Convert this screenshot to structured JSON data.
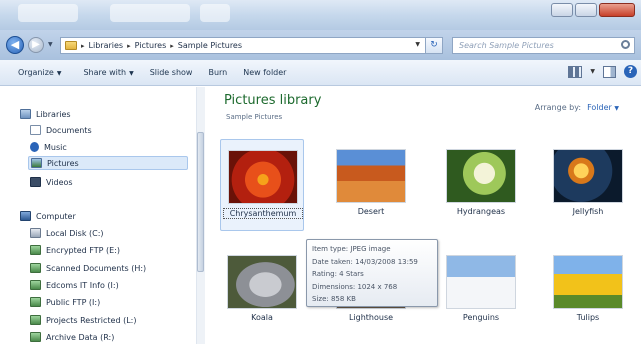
{
  "address": {
    "crumbs": [
      "Libraries",
      "Pictures",
      "Sample Pictures"
    ],
    "search_placeholder": "Search Sample Pictures"
  },
  "toolbar": {
    "organize": "Organize",
    "share_with": "Share with",
    "slide_show": "Slide show",
    "burn": "Burn",
    "new_folder": "New folder"
  },
  "sidebar": {
    "libraries": "Libraries",
    "documents": "Documents",
    "music": "Music",
    "pictures": "Pictures",
    "videos": "Videos",
    "computer": "Computer",
    "drives": [
      "Local Disk (C:)",
      "Encrypted FTP (E:)",
      "Scanned Documents (H:)",
      "Edcoms IT Info (I:)",
      "Public FTP (I:)",
      "Projects Restricted (L:)",
      "Archive Data (R:)"
    ]
  },
  "main": {
    "title": "Pictures library",
    "subtitle": "Sample Pictures",
    "arrange_label": "Arrange by:",
    "arrange_value": "Folder",
    "items": [
      "Chrysanthemum",
      "Desert",
      "Hydrangeas",
      "Jellyfish",
      "Koala",
      "Lighthouse",
      "Penguins",
      "Tulips"
    ]
  },
  "tooltip": {
    "item_type": "Item type: JPEG image",
    "date_taken": "Date taken: 14/03/2008 13:59",
    "rating": "Rating: 4 Stars",
    "dimensions": "Dimensions: 1024 x 768",
    "size": "Size: 858 KB"
  },
  "colors": {
    "title_green": "#1d6a2e",
    "link_blue": "#2a64b8",
    "selection": "#dbe9f9"
  }
}
